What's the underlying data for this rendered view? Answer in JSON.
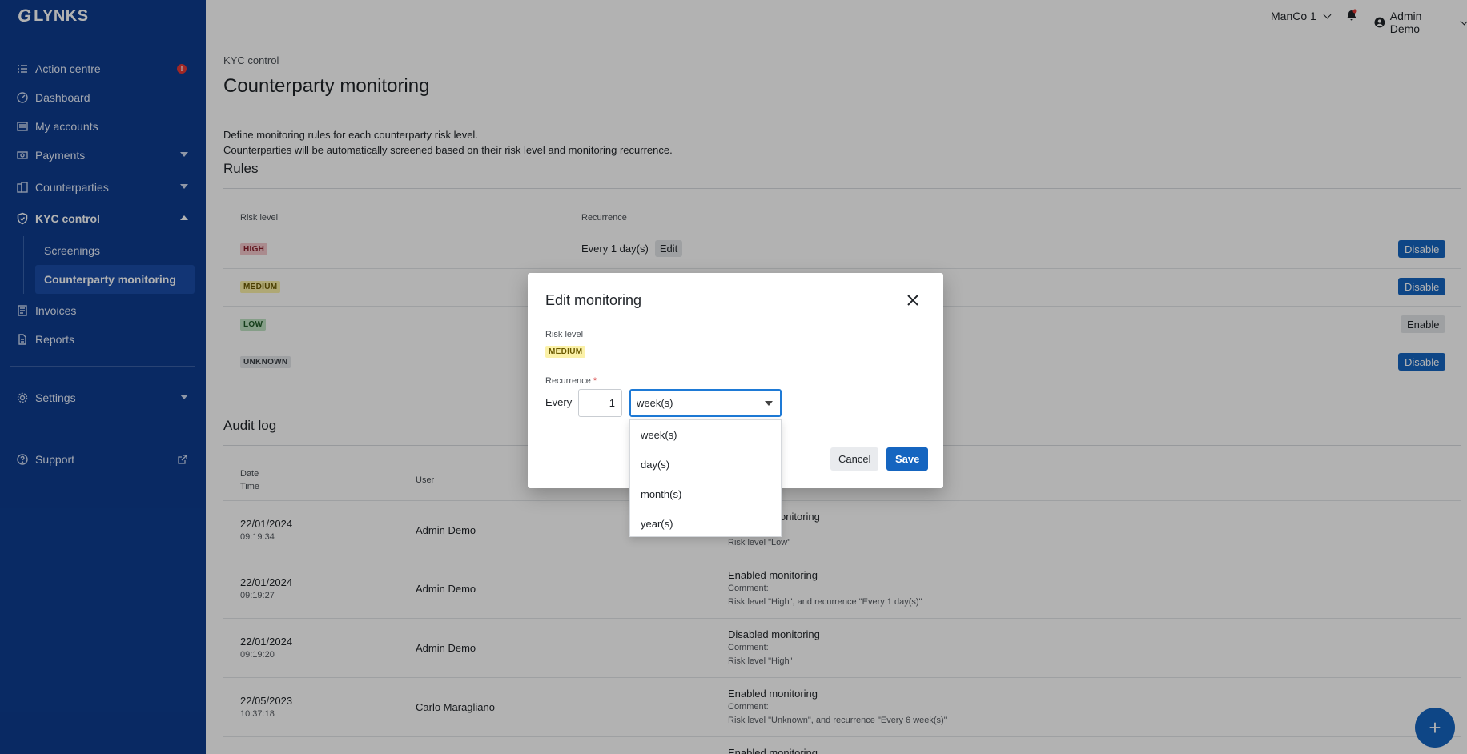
{
  "brand": {
    "logo_mark": "G",
    "name": "LYNKS"
  },
  "topbar": {
    "company": "ManCo 1",
    "user": "Admin Demo"
  },
  "sidebar": {
    "items": [
      {
        "label": "Action centre",
        "alert": "!"
      },
      {
        "label": "Dashboard"
      },
      {
        "label": "My accounts"
      },
      {
        "label": "Payments"
      },
      {
        "label": "Counterparties"
      },
      {
        "label": "KYC control"
      },
      {
        "label": "Invoices"
      },
      {
        "label": "Reports"
      },
      {
        "label": "Settings"
      },
      {
        "label": "Support"
      }
    ],
    "kyc_sub": [
      {
        "label": "Screenings"
      },
      {
        "label": "Counterparty monitoring"
      }
    ]
  },
  "page": {
    "breadcrumb": "KYC control",
    "title": "Counterparty monitoring",
    "desc1": "Define monitoring rules for each counterparty risk level.",
    "desc2": "Counterparties will be automatically screened based on their risk level and monitoring recurrence."
  },
  "rules": {
    "title": "Rules",
    "col_risk": "Risk level",
    "col_recurrence": "Recurrence",
    "rows": [
      {
        "risk": "HIGH",
        "recurrence": "Every 1 day(s)",
        "edit": "Edit",
        "action": "Disable"
      },
      {
        "risk": "MEDIUM",
        "action": "Disable"
      },
      {
        "risk": "LOW",
        "action": "Enable"
      },
      {
        "risk": "UNKNOWN",
        "action": "Disable"
      }
    ]
  },
  "audit": {
    "title": "Audit log",
    "col_date": "Date",
    "col_time": "Time",
    "col_user": "User",
    "rows": [
      {
        "date": "22/01/2024",
        "time": "09:19:34",
        "user": "Admin Demo",
        "action": "Disabled monitoring",
        "line2": "",
        "line3": "Risk level \"Low\""
      },
      {
        "date": "22/01/2024",
        "time": "09:19:27",
        "user": "Admin Demo",
        "action": "Enabled monitoring",
        "line2": "Comment:",
        "line3": "Risk level \"High\", and recurrence \"Every 1 day(s)\""
      },
      {
        "date": "22/01/2024",
        "time": "09:19:20",
        "user": "Admin Demo",
        "action": "Disabled monitoring",
        "line2": "Comment:",
        "line3": "Risk level \"High\""
      },
      {
        "date": "22/05/2023",
        "time": "10:37:18",
        "user": "Carlo Maragliano",
        "action": "Enabled monitoring",
        "line2": "Comment:",
        "line3": "Risk level \"Unknown\", and recurrence \"Every 6 week(s)\""
      },
      {
        "action": "Enabled monitoring"
      }
    ]
  },
  "fab": "+",
  "modal": {
    "title": "Edit monitoring",
    "risk_label": "Risk level",
    "risk_value": "MEDIUM",
    "recurrence_label": "Recurrence",
    "required_mark": "*",
    "every": "Every",
    "interval": "1",
    "unit_selected": "week(s)",
    "unit_options": [
      "week(s)",
      "day(s)",
      "month(s)",
      "year(s)"
    ],
    "cancel": "Cancel",
    "save": "Save"
  },
  "colors": {
    "sidebar_bg": "#0d3c8f",
    "primary": "#1565c0",
    "alert": "#e53935",
    "focus": "#1e7ad6"
  }
}
